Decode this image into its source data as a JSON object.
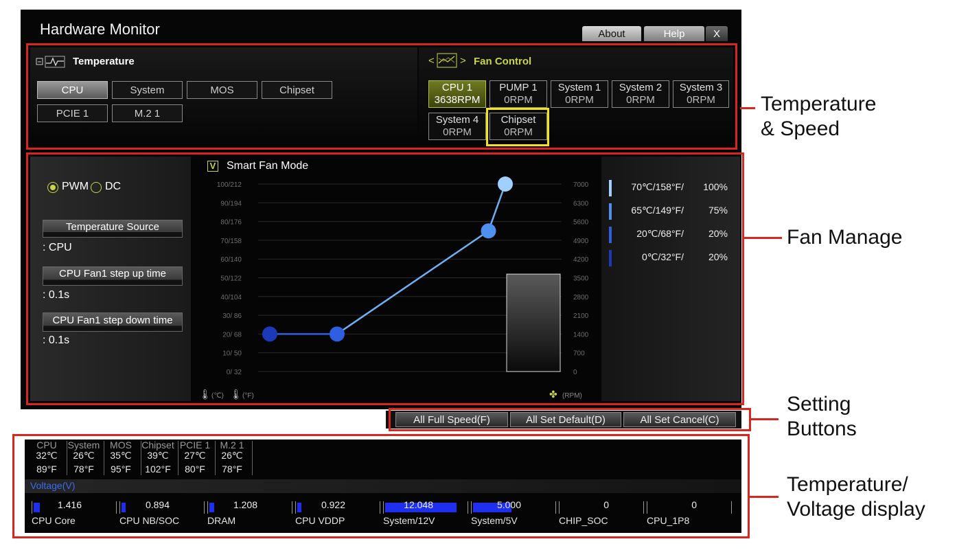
{
  "window": {
    "title": "Hardware Monitor",
    "tabs": [
      "About",
      "Help",
      "X"
    ]
  },
  "temperature": {
    "header": "Temperature",
    "buttons": [
      "CPU",
      "System",
      "MOS",
      "Chipset",
      "PCIE 1",
      "M.2 1"
    ],
    "selected": "CPU"
  },
  "fan_control": {
    "header": "Fan Control",
    "fans": [
      {
        "name": "CPU 1",
        "rpm": "3638RPM"
      },
      {
        "name": "PUMP 1",
        "rpm": "0RPM"
      },
      {
        "name": "System 1",
        "rpm": "0RPM"
      },
      {
        "name": "System 2",
        "rpm": "0RPM"
      },
      {
        "name": "System 3",
        "rpm": "0RPM"
      },
      {
        "name": "System 4",
        "rpm": "0RPM"
      },
      {
        "name": "Chipset",
        "rpm": "0RPM"
      }
    ]
  },
  "fan_manage": {
    "pwm_label": "PWM",
    "dc_label": "DC",
    "temp_source_label": "Temperature Source",
    "temp_source_value": ": CPU",
    "step_up_label": "CPU Fan1 step up time",
    "step_up_value": ": 0.1s",
    "step_down_label": "CPU Fan1 step down time",
    "step_down_value": ": 0.1s",
    "smart_fan_label": "Smart Fan Mode",
    "smart_fan_check": "V",
    "left_unit_c": "(℃)",
    "left_unit_f": "(°F)",
    "right_unit": "(RPM)"
  },
  "chart_data": {
    "type": "line",
    "y_left_ticks": [
      "100/212",
      "90/194",
      "80/176",
      "70/158",
      "60/140",
      "50/122",
      "40/104",
      "30/ 86",
      "20/ 68",
      "10/ 50",
      "0/ 32"
    ],
    "y_right_ticks": [
      "7000",
      "6300",
      "5600",
      "4900",
      "4200",
      "3500",
      "2800",
      "2100",
      "1400",
      "700",
      "0"
    ],
    "ylim": [
      0,
      100
    ],
    "points": [
      {
        "temp": 0,
        "speed": 20
      },
      {
        "temp": 20,
        "speed": 20
      },
      {
        "temp": 65,
        "speed": 75
      },
      {
        "temp": 70,
        "speed": 100
      }
    ],
    "current_rpm": 3638,
    "legend": [
      {
        "temp": "70℃/158°F/",
        "pct": "100%",
        "color": "#9fd0ff"
      },
      {
        "temp": "65℃/149°F/",
        "pct": "75%",
        "color": "#4f8ff0"
      },
      {
        "temp": "20℃/68°F/",
        "pct": "20%",
        "color": "#2d5fe0"
      },
      {
        "temp": "0℃/32°F/",
        "pct": "20%",
        "color": "#1c3ab8"
      }
    ]
  },
  "settings": {
    "buttons": [
      "All Full Speed(F)",
      "All Set Default(D)",
      "All Set Cancel(C)"
    ]
  },
  "temps_display": [
    {
      "name": "CPU",
      "c": "32℃",
      "f": "89°F"
    },
    {
      "name": "System",
      "c": "26℃",
      "f": "78°F"
    },
    {
      "name": "MOS",
      "c": "35℃",
      "f": "95°F"
    },
    {
      "name": "Chipset",
      "c": "39℃",
      "f": "102°F"
    },
    {
      "name": "PCIE 1",
      "c": "27℃",
      "f": "80°F"
    },
    {
      "name": "M.2 1",
      "c": "26℃",
      "f": "78°F"
    }
  ],
  "voltage": {
    "header": "Voltage(V)",
    "items": [
      {
        "name": "CPU Core",
        "value": "1.416",
        "fill": 0.08
      },
      {
        "name": "CPU NB/SOC",
        "value": "0.894",
        "fill": 0.05
      },
      {
        "name": "DRAM",
        "value": "1.208",
        "fill": 0.06
      },
      {
        "name": "CPU VDDP",
        "value": "0.922",
        "fill": 0.05
      },
      {
        "name": "System/12V",
        "value": "12.048",
        "fill": 0.93
      },
      {
        "name": "System/5V",
        "value": "5.000",
        "fill": 0.5
      },
      {
        "name": "CHIP_SOC",
        "value": "0",
        "fill": 0
      },
      {
        "name": "CPU_1P8",
        "value": "0",
        "fill": 0
      }
    ]
  },
  "annotations": {
    "temp_speed": [
      "Temperature",
      "& Speed"
    ],
    "fan_manage": "Fan Manage",
    "setting_buttons": [
      "Setting",
      "Buttons"
    ],
    "tv_display": [
      "Temperature/",
      "Voltage display"
    ]
  },
  "colors": {
    "annotation_red": "#d8261f",
    "fan_selected": "#6f7a20",
    "highlight_yellow": "#f4e21a",
    "voltage_bar": "#1f2ff0"
  }
}
